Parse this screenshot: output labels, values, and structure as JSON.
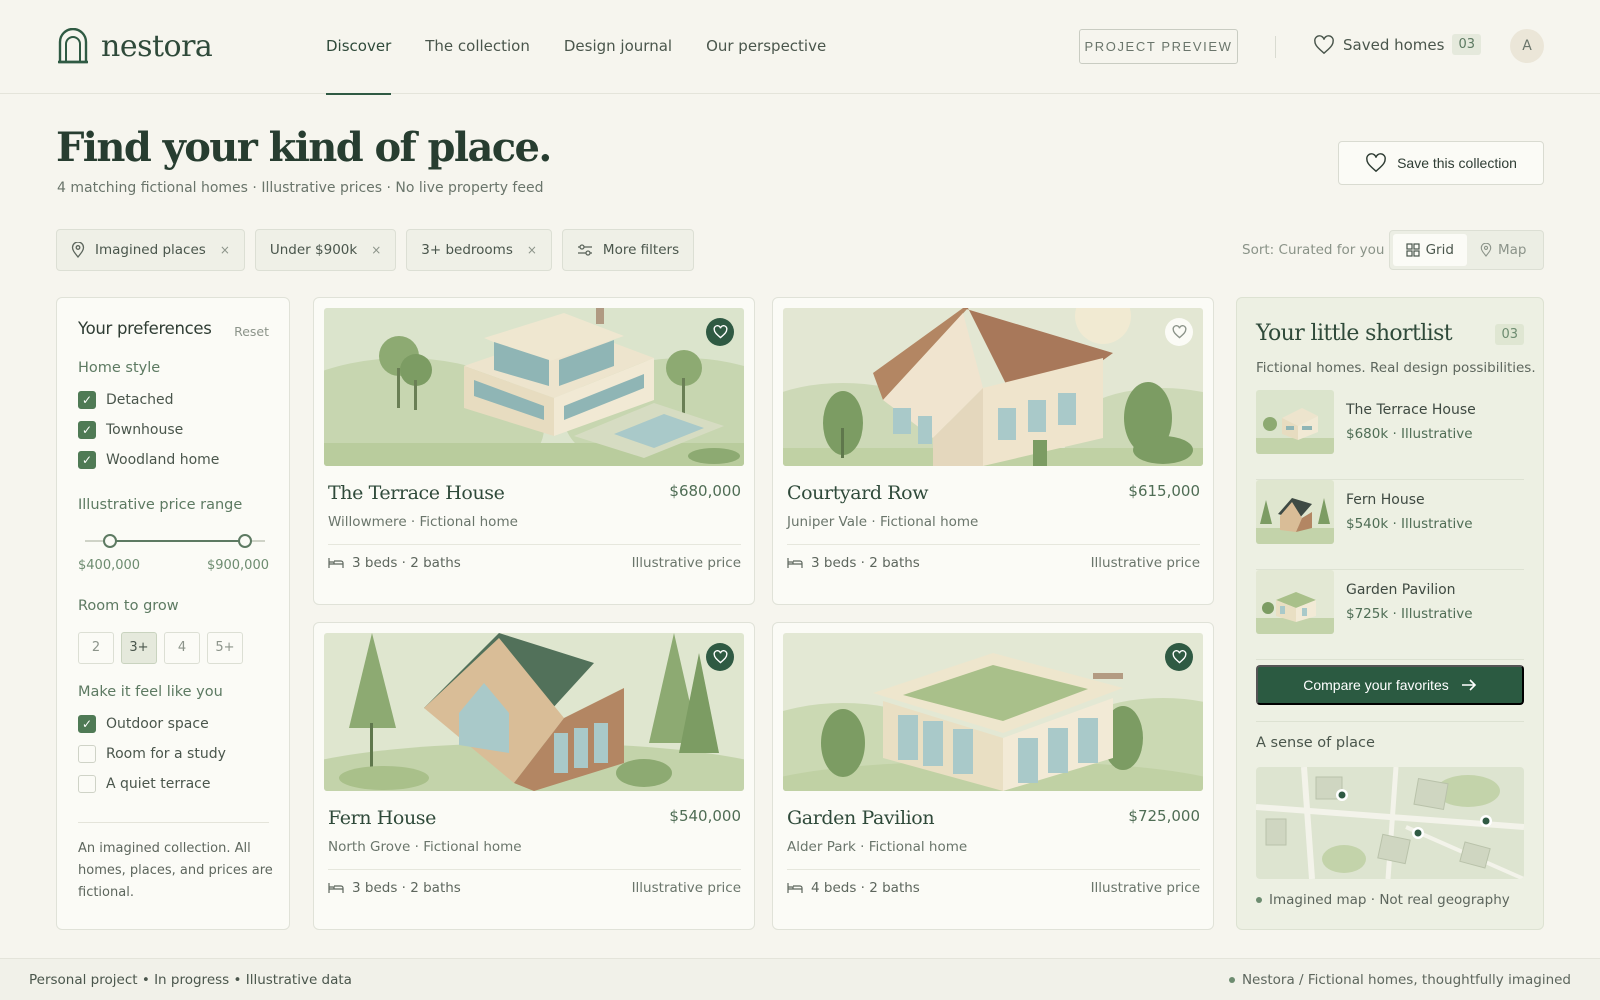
{
  "brand": {
    "name": "nestora"
  },
  "nav": [
    {
      "label": "Discover",
      "active": true
    },
    {
      "label": "The collection"
    },
    {
      "label": "Design journal"
    },
    {
      "label": "Our perspective"
    }
  ],
  "header": {
    "preview_label": "PROJECT PREVIEW",
    "saved_label": "Saved homes",
    "saved_count": "03",
    "avatar_initial": "A"
  },
  "hero": {
    "title": "Find your kind of place.",
    "subtitle": "4 matching fictional homes · Illustrative prices · No live property feed",
    "save_label": "Save this collection"
  },
  "filters": {
    "chips": [
      {
        "label": "Imagined places",
        "icon": "pin-icon"
      },
      {
        "label": "Under $900k"
      },
      {
        "label": "3+ bedrooms"
      }
    ],
    "more_label": "More filters",
    "sort_label": "Sort: Curated for you",
    "view_grid": "Grid",
    "view_map": "Map",
    "active_view": "Grid"
  },
  "prefs": {
    "title": "Your preferences",
    "reset": "Reset",
    "home_style_heading": "Home style",
    "home_styles": [
      {
        "label": "Detached",
        "checked": true
      },
      {
        "label": "Townhouse",
        "checked": true
      },
      {
        "label": "Woodland home",
        "checked": true
      }
    ],
    "price_heading": "Illustrative price range",
    "price_min": "$400,000",
    "price_max": "$900,000",
    "price_min_fraction": 0.11,
    "price_max_fraction": 0.92,
    "room_heading": "Room to grow",
    "rooms": [
      "2",
      "3+",
      "4",
      "5+"
    ],
    "rooms_selected": "3+",
    "feel_heading": "Make it feel like you",
    "feel": [
      {
        "label": "Outdoor space",
        "checked": true
      },
      {
        "label": "Room for a study",
        "checked": false
      },
      {
        "label": "A quiet terrace",
        "checked": false
      }
    ],
    "note": "An imagined collection. All homes, places, and prices are fictional."
  },
  "listings": [
    {
      "name": "The Terrace House",
      "price": "$680,000",
      "location": "Willowmere · Fictional home",
      "beds": "3 beds · 2 baths",
      "tag": "Illustrative price",
      "favorited": true
    },
    {
      "name": "Courtyard Row",
      "price": "$615,000",
      "location": "Juniper Vale · Fictional home",
      "beds": "3 beds · 2 baths",
      "tag": "Illustrative price",
      "favorited": false
    },
    {
      "name": "Fern House",
      "price": "$540,000",
      "location": "North Grove · Fictional home",
      "beds": "3 beds · 2 baths",
      "tag": "Illustrative price",
      "favorited": true
    },
    {
      "name": "Garden Pavilion",
      "price": "$725,000",
      "location": "Alder Park · Fictional home",
      "beds": "4 beds · 2 baths",
      "tag": "Illustrative price",
      "favorited": true
    }
  ],
  "shortlist": {
    "title": "Your little shortlist",
    "count": "03",
    "subtitle": "Fictional homes. Real design possibilities.",
    "items": [
      {
        "name": "The Terrace House",
        "meta": "$680k · Illustrative"
      },
      {
        "name": "Fern House",
        "meta": "$540k · Illustrative"
      },
      {
        "name": "Garden Pavilion",
        "meta": "$725k · Illustrative"
      }
    ],
    "compare_label": "Compare your favorites",
    "place_heading": "A sense of place",
    "map_note": "Imagined map · Not real geography"
  },
  "footer": {
    "left": "Personal project • In progress • Illustrative data",
    "right": "Nestora / Fictional homes, thoughtfully imagined"
  },
  "colors": {
    "accent": "#2b5a41",
    "sage": "#5d7a62",
    "background": "#f6f5ee"
  }
}
